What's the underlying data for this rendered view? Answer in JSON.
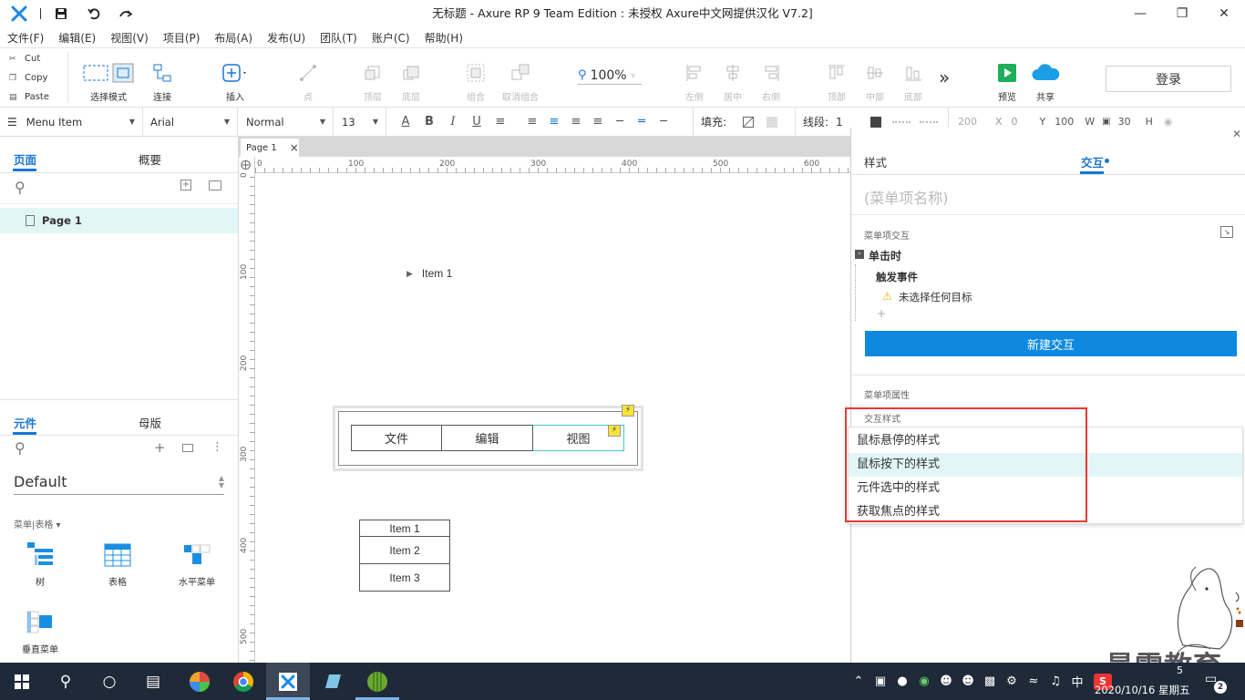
{
  "titlebar": {
    "title": "无标题 - Axure RP 9 Team Edition : 未授权    Axure中文网提供汉化 V7.2]"
  },
  "menus": [
    "文件(F)",
    "编辑(E)",
    "视图(V)",
    "项目(P)",
    "布局(A)",
    "发布(U)",
    "团队(T)",
    "账户(C)",
    "帮助(H)"
  ],
  "clipboard": {
    "cut": "Cut",
    "copy": "Copy",
    "paste": "Paste"
  },
  "toolbar": {
    "select_mode": "选择模式",
    "connect": "连接",
    "insert": "插入",
    "point": "点",
    "top_layer": "顶层",
    "bottom_layer": "底层",
    "group": "组合",
    "ungroup": "取消组合",
    "zoom": "100%",
    "align_left": "左侧",
    "align_center": "居中",
    "align_right": "右侧",
    "align_top": "顶部",
    "align_middle": "中部",
    "align_bottom": "底部",
    "more": "»",
    "preview": "预览",
    "share": "共享",
    "login": "登录"
  },
  "format": {
    "element_type": "Menu Item",
    "font": "Arial",
    "weight": "Normal",
    "size": "13",
    "fill_label": "填充:",
    "line_label": "线段:",
    "line_value": "1",
    "x_label": "X",
    "x_value": "0",
    "x_prev": "200",
    "y_label": "Y",
    "y_value": "100",
    "w_label": "W",
    "w_value": "30",
    "h_label": "H"
  },
  "left": {
    "tab_pages": "页面",
    "tab_outline": "概要",
    "page1": "Page 1",
    "tab_widgets": "元件",
    "tab_masters": "母版",
    "library": "Default",
    "category": "菜单|表格 ▾",
    "widgets": [
      "树",
      "表格",
      "水平菜单",
      "垂直菜单"
    ]
  },
  "canvas": {
    "page_tab": "Page 1",
    "close": "×",
    "ticks_x": [
      "0",
      "100",
      "200",
      "300",
      "400",
      "500",
      "600"
    ],
    "ticks_y": [
      "0",
      "100",
      "200",
      "300",
      "400",
      "500"
    ],
    "item1": "Item 1",
    "hmenu": [
      "文件",
      "编辑",
      "视图"
    ],
    "vmenu": [
      "Item 1",
      "Item 2",
      "Item 3"
    ]
  },
  "right": {
    "tab_style": "样式",
    "tab_interaction": "交互",
    "name_placeholder": "(菜单项名称)",
    "section_interaction": "菜单项交互",
    "event": "单击时",
    "trigger": "触发事件",
    "warning": "未选择任何目标",
    "add": "+",
    "new_interaction": "新建交互",
    "section_props": "菜单项属性",
    "interaction_styles": "交互样式",
    "styles": [
      "鼠标悬停的样式",
      "鼠标按下的样式",
      "元件选中的样式",
      "获取焦点的样式"
    ]
  },
  "taskbar": {
    "time": "5",
    "date": "2020/10/16 星期五",
    "ime": "中",
    "notifications": "2"
  },
  "watermark": {
    "text": "最需教育"
  },
  "colors": {
    "accent": "#1a76d2",
    "highlight_red": "#e53935",
    "button_blue": "#0d89e0"
  }
}
